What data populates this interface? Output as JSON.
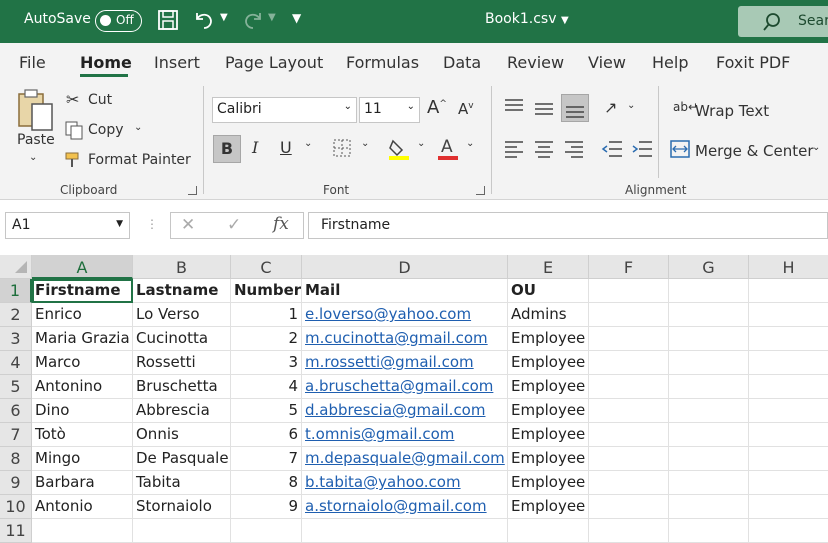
{
  "titlebar": {
    "autosave_label": "AutoSave",
    "autosave_state": "Off",
    "document_title": "Book1.csv",
    "search_label": "Sear"
  },
  "tabs": [
    "File",
    "Home",
    "Insert",
    "Page Layout",
    "Formulas",
    "Data",
    "Review",
    "View",
    "Help",
    "Foxit PDF"
  ],
  "active_tab": "Home",
  "ribbon": {
    "clipboard": {
      "paste": "Paste",
      "cut": "Cut",
      "copy": "Copy",
      "format_painter": "Format Painter",
      "label": "Clipboard"
    },
    "font": {
      "font_name": "Calibri",
      "font_size": "11",
      "label": "Font",
      "fill_color": "#ffff00",
      "font_color": "#e03030"
    },
    "alignment": {
      "wrap_text": "Wrap Text",
      "merge_center": "Merge & Center",
      "label": "Alignment"
    }
  },
  "formula_bar": {
    "name_box": "A1",
    "fx": "fx",
    "content": "Firstname"
  },
  "sheet": {
    "columns": [
      "A",
      "B",
      "C",
      "D",
      "E",
      "F",
      "G",
      "H"
    ],
    "rows": [
      "1",
      "2",
      "3",
      "4",
      "5",
      "6",
      "7",
      "8",
      "9",
      "10",
      "11"
    ],
    "header_row": [
      "Firstname",
      "Lastname",
      "Number",
      "Mail",
      "OU"
    ],
    "data": [
      [
        "Enrico",
        " Lo Verso",
        "1",
        "e.loverso@yahoo.com",
        "Admins"
      ],
      [
        "Maria Grazia",
        " Cucinotta",
        "2",
        "m.cucinotta@gmail.com",
        "Employee"
      ],
      [
        "Marco",
        " Rossetti",
        "3",
        "m.rossetti@gmail.com",
        "Employee"
      ],
      [
        "Antonino",
        "Bruschetta",
        "4",
        "a.bruschetta@gmail.com",
        "Employee"
      ],
      [
        "Dino",
        "Abbrescia",
        "5",
        "d.abbrescia@gmail.com",
        "Employee"
      ],
      [
        "Totò",
        "Onnis",
        "6",
        "t.omnis@gmail.com",
        "Employee"
      ],
      [
        "Mingo",
        "De Pasquale",
        "7",
        "m.depasquale@gmail.com",
        "Employee"
      ],
      [
        "Barbara",
        "Tabita",
        "8",
        "b.tabita@yahoo.com",
        "Employee"
      ],
      [
        "Antonio",
        "Stornaiolo",
        "9",
        "a.stornaiolo@gmail.com",
        "Employee"
      ]
    ]
  },
  "colors": {
    "accent": "#217346",
    "link": "#1f5fb0"
  }
}
